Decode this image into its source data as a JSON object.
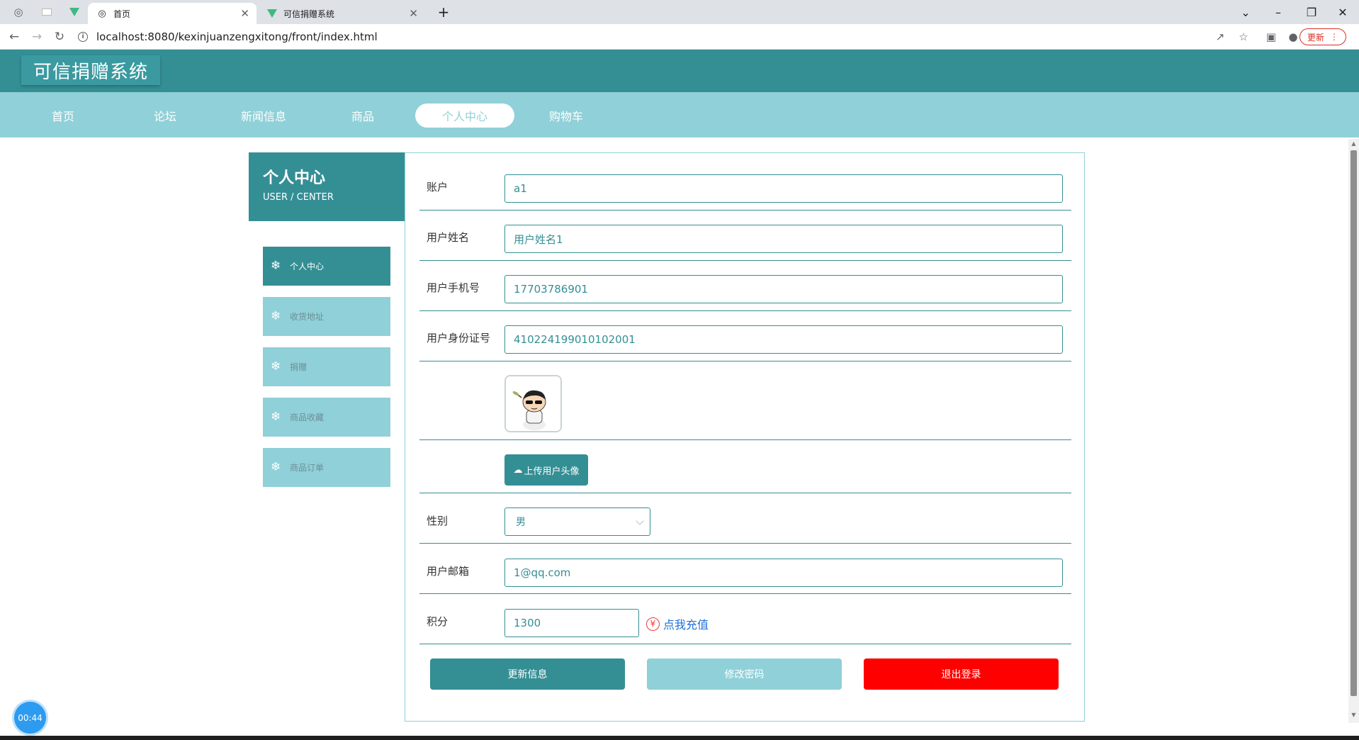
{
  "browser": {
    "tabs": [
      {
        "title": "首页",
        "favicon": "globe-icon",
        "active": true
      },
      {
        "title": "可信捐赠系统",
        "favicon": "vue-icon",
        "active": false
      }
    ],
    "url": "localhost:8080/kexinjuanzengxitong/front/index.html",
    "update_label": "更新"
  },
  "site": {
    "logo": "可信捐赠系统",
    "nav": [
      "首页",
      "论坛",
      "新闻信息",
      "商品",
      "个人中心",
      "购物车"
    ],
    "active_nav": "个人中心"
  },
  "sidebar": {
    "title": "个人中心",
    "subtitle": "USER / CENTER",
    "items": [
      {
        "label": "个人中心",
        "active": true
      },
      {
        "label": "收货地址",
        "active": false
      },
      {
        "label": "捐赠",
        "active": false
      },
      {
        "label": "商品收藏",
        "active": false
      },
      {
        "label": "商品订单",
        "active": false
      }
    ]
  },
  "form": {
    "account": {
      "label": "账户",
      "value": "a1"
    },
    "name": {
      "label": "用户姓名",
      "value": "用户姓名1"
    },
    "phone": {
      "label": "用户手机号",
      "value": "17703786901"
    },
    "id_card": {
      "label": "用户身份证号",
      "value": "410224199010102001"
    },
    "upload_label": "上传用户头像",
    "gender": {
      "label": "性别",
      "value": "男"
    },
    "email": {
      "label": "用户邮箱",
      "value": "1@qq.com"
    },
    "points": {
      "label": "积分",
      "value": "1300"
    },
    "recharge_label": "点我充值",
    "buttons": {
      "update": "更新信息",
      "change_password": "修改密码",
      "logout": "退出登录"
    }
  },
  "timer": "00:44",
  "colors": {
    "primary": "#348f95",
    "light": "#90d0d8",
    "danger": "#ff0000"
  }
}
